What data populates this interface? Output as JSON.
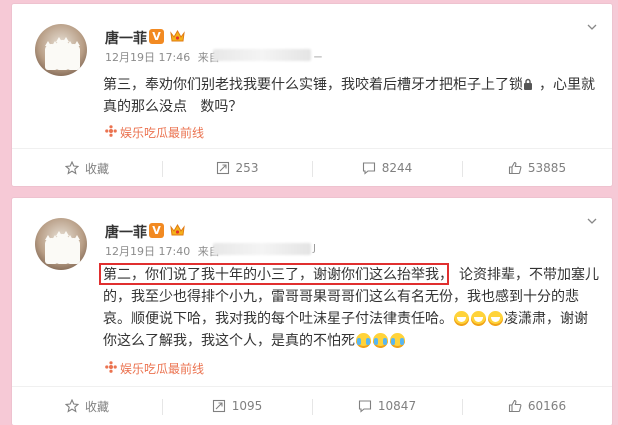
{
  "posts": [
    {
      "username": "唐一菲",
      "v_badge": "V",
      "timestamp": "12月19日 17:46",
      "from_label": "来自",
      "source_blurred_tail": "ㄧ",
      "text_lines": [
        "第三，奉劝你们别老找我要什么实锤，我咬着后槽牙才把柜子上了锁",
        "，心里就",
        "真的那么没点   数吗？"
      ],
      "source_tag": "娱乐吃瓜最前线",
      "actions": {
        "favorite": "收藏",
        "repost": "253",
        "comment": "8244",
        "like": "53885"
      }
    },
    {
      "username": "唐一菲",
      "v_badge": "V",
      "timestamp": "12月19日 17:40",
      "from_label": "来自",
      "source_blurred_tail": "J",
      "text_lines": [
        "第二，你们说了我十年的小三了，谢谢你们这么抬举我，",
        "论资排辈，不带加塞儿",
        "的，我至少也得排个小九，雷哥哥果哥哥们这么有名无份，我也感到十分的悲",
        "哀。顺便说下哈，我对我的每个吐沫星子付法律责任哈。",
        "凌潇肃，谢谢",
        "你这么了解我，我这个人，是真的不怕死"
      ],
      "source_tag": "娱乐吃瓜最前线",
      "actions": {
        "favorite": "收藏",
        "repost": "1095",
        "comment": "10847",
        "like": "60166"
      }
    }
  ],
  "icons": {
    "verified": "verified-v-icon",
    "crown": "crown-badge-icon",
    "lock": "lock-icon",
    "source": "source-tag-icon",
    "favorite": "star-icon",
    "repost": "repost-icon",
    "comment": "comment-icon",
    "like": "thumbs-up-icon",
    "dropdown": "chevron-down-icon"
  },
  "colors": {
    "background": "#f6c9d6",
    "card": "#ffffff",
    "source_link": "#eb7350",
    "v_badge": "#f28a22",
    "highlight_box": "#e02f2f"
  }
}
